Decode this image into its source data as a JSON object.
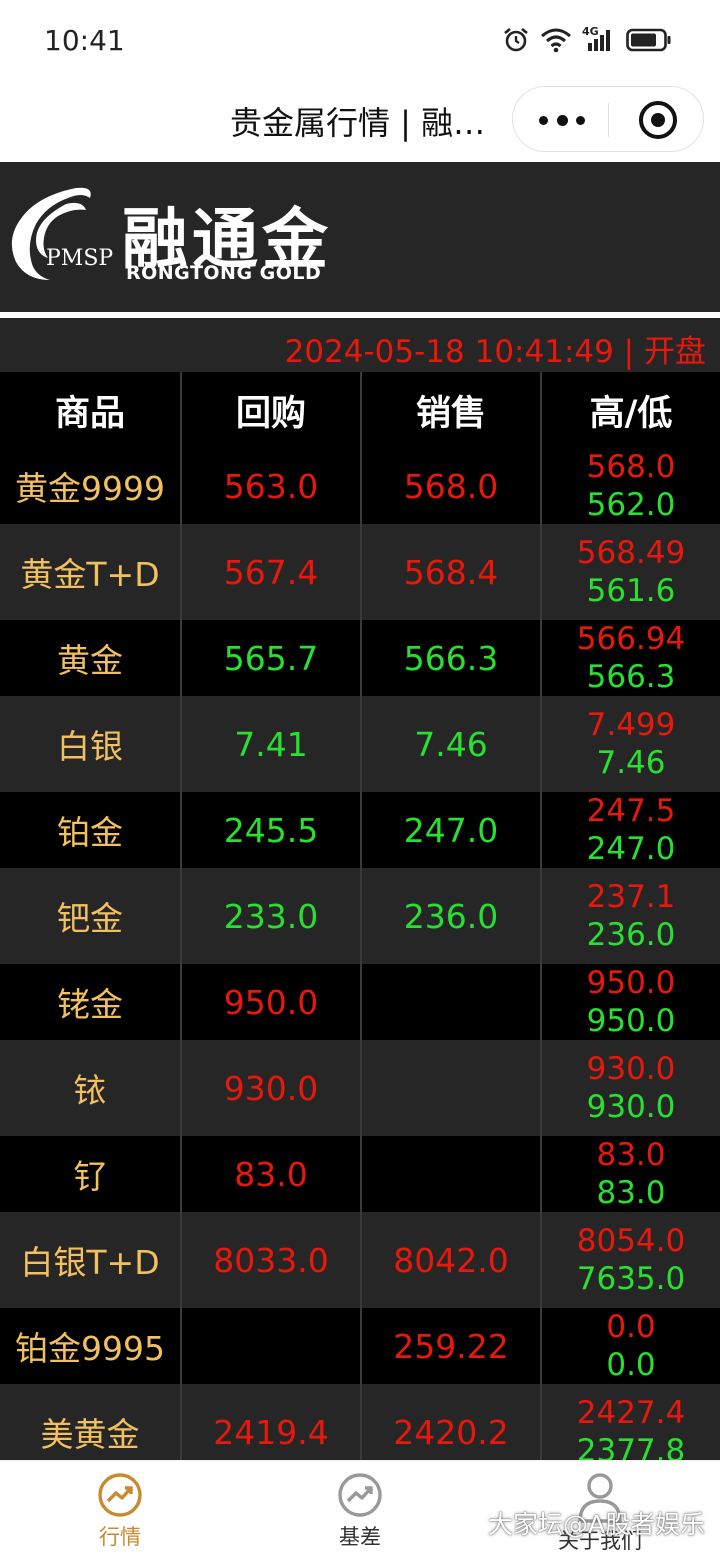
{
  "status": {
    "time": "10:41",
    "network": "4G"
  },
  "title_bar": {
    "title": "贵金属行情 | 融…"
  },
  "logo": {
    "mark": "PMSP",
    "brand_cn": "融通金",
    "brand_en": "RONGTONG  GOLD"
  },
  "datetime": {
    "text": "2024-05-18 10:41:49 | 开盘"
  },
  "table": {
    "headers": [
      "商品",
      "回购",
      "销售",
      "高/低"
    ],
    "rows": [
      {
        "name": "黄金9999",
        "buy": "563.0",
        "buy_color": "red",
        "sell": "568.0",
        "sell_color": "red",
        "high": "568.0",
        "low": "562.0"
      },
      {
        "name": "黄金T+D",
        "buy": "567.4",
        "buy_color": "red",
        "sell": "568.4",
        "sell_color": "red",
        "high": "568.49",
        "low": "561.6"
      },
      {
        "name": "黄金",
        "buy": "565.7",
        "buy_color": "green",
        "sell": "566.3",
        "sell_color": "green",
        "high": "566.94",
        "low": "566.3"
      },
      {
        "name": "白银",
        "buy": "7.41",
        "buy_color": "green",
        "sell": "7.46",
        "sell_color": "green",
        "high": "7.499",
        "low": "7.46"
      },
      {
        "name": "铂金",
        "buy": "245.5",
        "buy_color": "green",
        "sell": "247.0",
        "sell_color": "green",
        "high": "247.5",
        "low": "247.0"
      },
      {
        "name": "钯金",
        "buy": "233.0",
        "buy_color": "green",
        "sell": "236.0",
        "sell_color": "green",
        "high": "237.1",
        "low": "236.0"
      },
      {
        "name": "铑金",
        "buy": "950.0",
        "buy_color": "red",
        "sell": "",
        "sell_color": "red",
        "high": "950.0",
        "low": "950.0"
      },
      {
        "name": "铱",
        "buy": "930.0",
        "buy_color": "red",
        "sell": "",
        "sell_color": "red",
        "high": "930.0",
        "low": "930.0"
      },
      {
        "name": "钌",
        "buy": "83.0",
        "buy_color": "red",
        "sell": "",
        "sell_color": "red",
        "high": "83.0",
        "low": "83.0"
      },
      {
        "name": "白银T+D",
        "buy": "8033.0",
        "buy_color": "red",
        "sell": "8042.0",
        "sell_color": "red",
        "high": "8054.0",
        "low": "7635.0"
      },
      {
        "name": "铂金9995",
        "buy": "",
        "buy_color": "red",
        "sell": "259.22",
        "sell_color": "red",
        "high": "0.0",
        "low": "0.0"
      },
      {
        "name": "美黄金",
        "buy": "2419.4",
        "buy_color": "red",
        "sell": "2420.2",
        "sell_color": "red",
        "high": "2427.4",
        "low": "2377.8"
      }
    ]
  },
  "bottom_nav": [
    {
      "label": "行情",
      "icon": "trend-icon",
      "active": true
    },
    {
      "label": "基差",
      "icon": "trend-icon",
      "active": false
    },
    {
      "label": "关于我们",
      "icon": "user-icon",
      "active": false
    }
  ],
  "watermark": "大家坛@A股者娱乐",
  "colors": {
    "up": "#e8180c",
    "down": "#27e030",
    "name": "#f3c060",
    "accent": "#c98a2e",
    "band": "#262626"
  }
}
